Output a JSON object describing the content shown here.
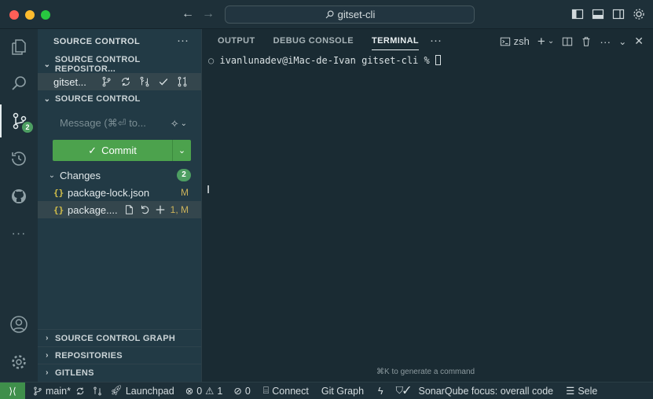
{
  "title_bar": {
    "search_text": "gitset-cli",
    "back": "←",
    "forward": "→"
  },
  "activity_bar": {
    "source_control_badge": "2"
  },
  "sidebar": {
    "header": "SOURCE CONTROL",
    "repositories_header": "SOURCE CONTROL REPOSITOR...",
    "repo_name": "gitset...",
    "source_control_header": "SOURCE CONTROL",
    "message_placeholder": "Message (⌘⏎ to...",
    "commit_label": "Commit",
    "changes_label": "Changes",
    "changes_count": "2",
    "files": [
      {
        "name": "package-lock.json",
        "status": "M"
      },
      {
        "name": "package....",
        "status": "1, M"
      }
    ],
    "bottom_sections": [
      "SOURCE CONTROL GRAPH",
      "REPOSITORIES",
      "GITLENS"
    ]
  },
  "panel": {
    "tabs": [
      "OUTPUT",
      "DEBUG CONSOLE",
      "TERMINAL"
    ],
    "active_tab": "TERMINAL",
    "shell": "zsh",
    "prompt": "ivanlunadev@iMac-de-Ivan gitset-cli %",
    "hint": "⌘K to generate a command"
  },
  "status_bar": {
    "branch": "main*",
    "launchpad": "Launchpad",
    "errors": "0",
    "warnings": "1",
    "ports": "0",
    "connect": "Connect",
    "git_graph": "Git Graph",
    "sonarqube": "SonarQube focus: overall code",
    "select": "Sele"
  },
  "colors": {
    "accent_green": "#4ca24d",
    "badge_green": "#4d9e62",
    "modified_yellow": "#cbb25a"
  }
}
